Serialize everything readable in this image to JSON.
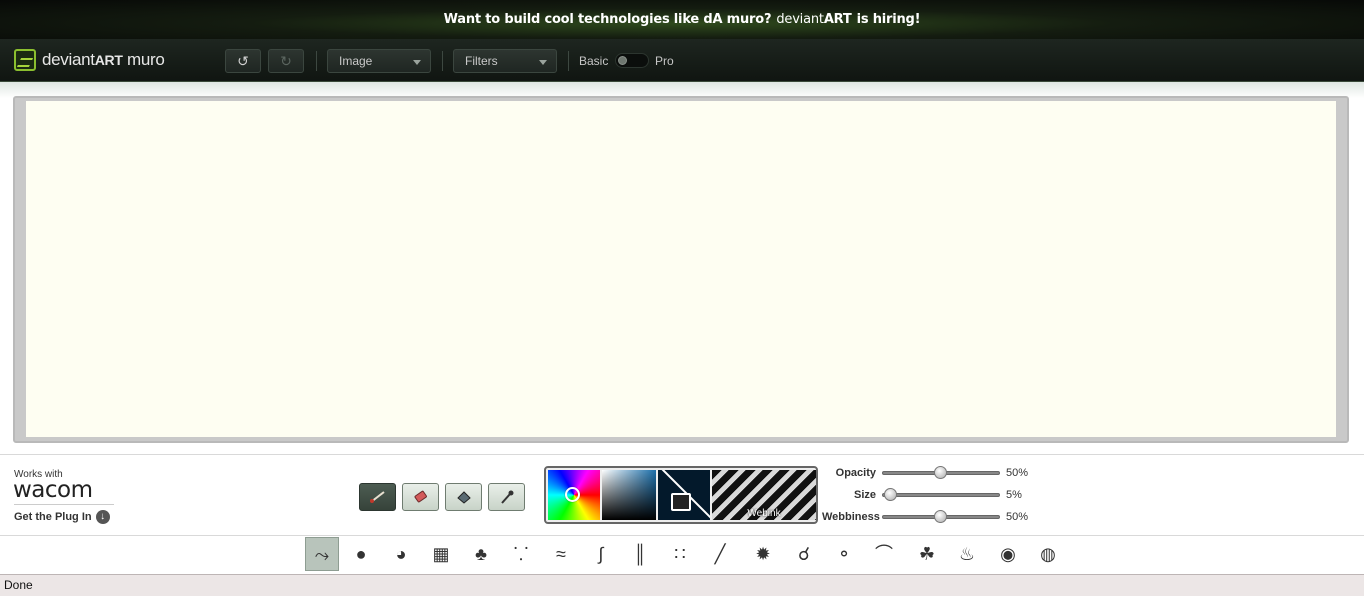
{
  "banner": {
    "text_main": "Want to build cool technologies like dA muro?",
    "text_brand_light": "deviant",
    "text_brand_bold": "ART",
    "text_tail": "is hiring!"
  },
  "app": {
    "logo_light": "deviant",
    "logo_bold": "ART",
    "logo_suffix": " muro"
  },
  "toolbar": {
    "undo_icon": "undo-icon",
    "redo_icon": "redo-icon",
    "image_menu": "Image",
    "filters_menu": "Filters",
    "mode_basic": "Basic",
    "mode_pro": "Pro"
  },
  "wacom": {
    "works_with": "Works with",
    "logo": "wacom",
    "plugin_link": "Get the Plug In"
  },
  "tools": [
    {
      "name": "brush-tool",
      "active": true
    },
    {
      "name": "eraser-tool",
      "active": false
    },
    {
      "name": "fill-tool",
      "active": false
    },
    {
      "name": "eyedropper-tool",
      "active": false
    }
  ],
  "colors": {
    "current": "#03192b",
    "texture_label": "Webink"
  },
  "sliders": {
    "opacity": {
      "label": "Opacity",
      "value": "50%",
      "level": 0.5
    },
    "size": {
      "label": "Size",
      "value": "5%",
      "level": 0.05
    },
    "webbiness": {
      "label": "Webbiness",
      "value": "50%",
      "level": 0.5
    }
  },
  "brushes": [
    "squiggle-brush",
    "round-brush",
    "pie-brush",
    "crosshatch-brush",
    "drip-brush",
    "splatter-brush",
    "spring-brush",
    "swirl-brush",
    "lines-brush",
    "dots-brush",
    "hatch-brush",
    "star-brush",
    "link-brush",
    "ring-brush",
    "wing-brush",
    "sprig-brush",
    "flame-brush",
    "sphere-brush",
    "globe-brush"
  ],
  "status": {
    "text": "Done"
  }
}
